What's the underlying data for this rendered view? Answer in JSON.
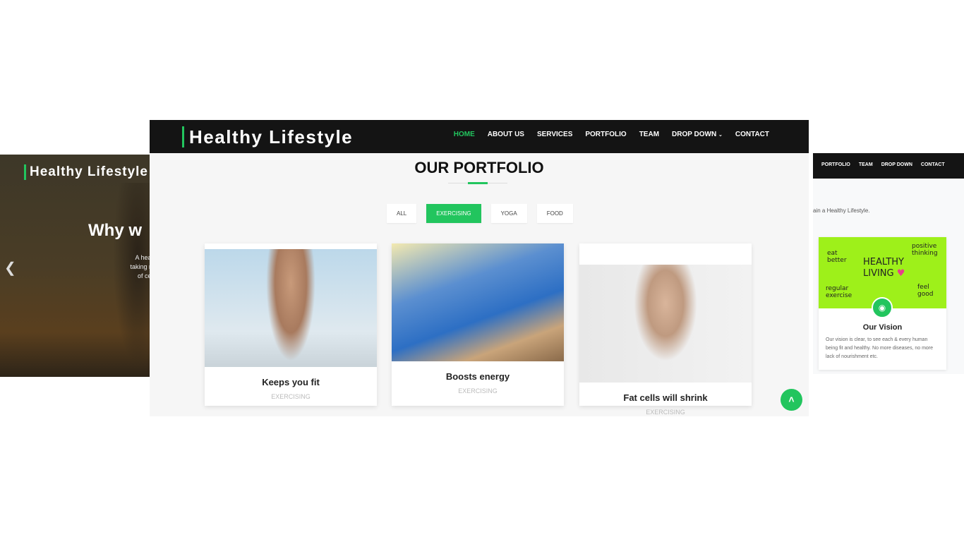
{
  "left_slide": {
    "brand": "Healthy Lifestyle",
    "heading": "Why w",
    "text_lines": [
      "A healthy lifestyl",
      "taking regular exe",
      "of certain disea"
    ],
    "prev_icon": "chevron-left-icon"
  },
  "main": {
    "brand": "Healthy Lifestyle",
    "nav": [
      "HOME",
      "ABOUT US",
      "SERVICES",
      "PORTFOLIO",
      "TEAM",
      "DROP DOWN",
      "CONTACT"
    ],
    "section_title": "OUR PORTFOLIO",
    "filters": [
      "ALL",
      "EXERCISING",
      "YOGA",
      "FOOD"
    ],
    "active_filter": "EXERCISING",
    "cards": [
      {
        "title": "Keeps you fit",
        "category": "EXERCISING"
      },
      {
        "title": "Boosts energy",
        "category": "EXERCISING"
      },
      {
        "title": "Fat cells will shrink",
        "category": "EXERCISING"
      }
    ],
    "accent": "#22c55e"
  },
  "right_slide": {
    "nav": [
      "PORTFOLIO",
      "TEAM",
      "DROP DOWN",
      "CONTACT"
    ],
    "intro": "ain a Healthy Lifestyle.",
    "image_words": [
      "HEALTHY",
      "LIVING",
      "eat better",
      "positive thinking",
      "feel good",
      "regular exercise"
    ],
    "vision_title": "Our Vision",
    "vision_text": "Our vision is clear, to see each & every human being fit and healthy. No more diseases, no more lack of nourishment etc."
  }
}
